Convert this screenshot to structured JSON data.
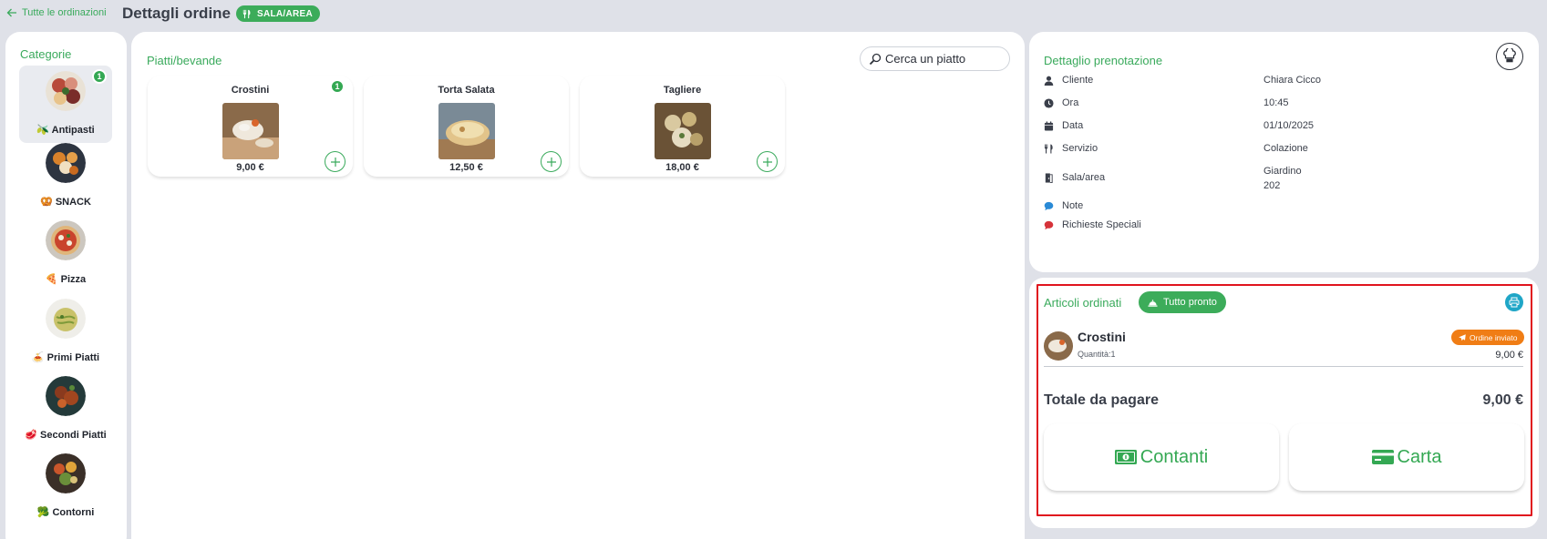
{
  "header": {
    "back_label": "Tutte le ordinazioni",
    "title": "Dettagli ordine",
    "badge": "SALA/AREA"
  },
  "categories": {
    "title": "Categorie",
    "items": [
      {
        "label": "🫒 Antipasti",
        "count": "1",
        "active": true
      },
      {
        "label": "🥨 SNACK"
      },
      {
        "label": "🍕 Pizza"
      },
      {
        "label": "🍝 Primi Piatti"
      },
      {
        "label": "🥩 Secondi Piatti"
      },
      {
        "label": "🥦 Contorni"
      }
    ]
  },
  "dishes": {
    "title": "Piatti/bevande",
    "search_placeholder": "Cerca un piatto",
    "items": [
      {
        "name": "Crostini",
        "price": "9,00 €",
        "count": "1"
      },
      {
        "name": "Torta Salata",
        "price": "12,50 €"
      },
      {
        "name": "Tagliere",
        "price": "18,00 €"
      }
    ]
  },
  "reservation": {
    "title": "Dettaglio prenotazione",
    "rows": [
      {
        "label": "Cliente",
        "value": "Chiara Cicco",
        "icon": "user-icon"
      },
      {
        "label": "Ora",
        "value": "10:45",
        "icon": "clock-icon"
      },
      {
        "label": "Data",
        "value": "01/10/2025",
        "icon": "calendar-icon"
      },
      {
        "label": "Servizio",
        "value": "Colazione",
        "icon": "utensils-icon"
      },
      {
        "label": "Sala/area",
        "value": "Giardino",
        "value2": "202",
        "icon": "door-icon"
      },
      {
        "label": "Note",
        "value": "",
        "icon": "comment-icon"
      },
      {
        "label": "Richieste Speciali",
        "value": "",
        "icon": "comment-red-icon"
      }
    ]
  },
  "order": {
    "title": "Articoli ordinati",
    "ready_label": "Tutto pronto",
    "item": {
      "name": "Crostini",
      "qty": "Quantità:1",
      "status": "Ordine inviato",
      "price": "9,00 €"
    },
    "total_label": "Totale da pagare",
    "total_value": "9,00 €",
    "pay_cash": "Contanti",
    "pay_card": "Carta"
  },
  "colors": {
    "accent": "#3aaa5c",
    "status_orange": "#f07d15",
    "highlight_red": "#e0141e",
    "print_blue": "#1fa6c7"
  }
}
